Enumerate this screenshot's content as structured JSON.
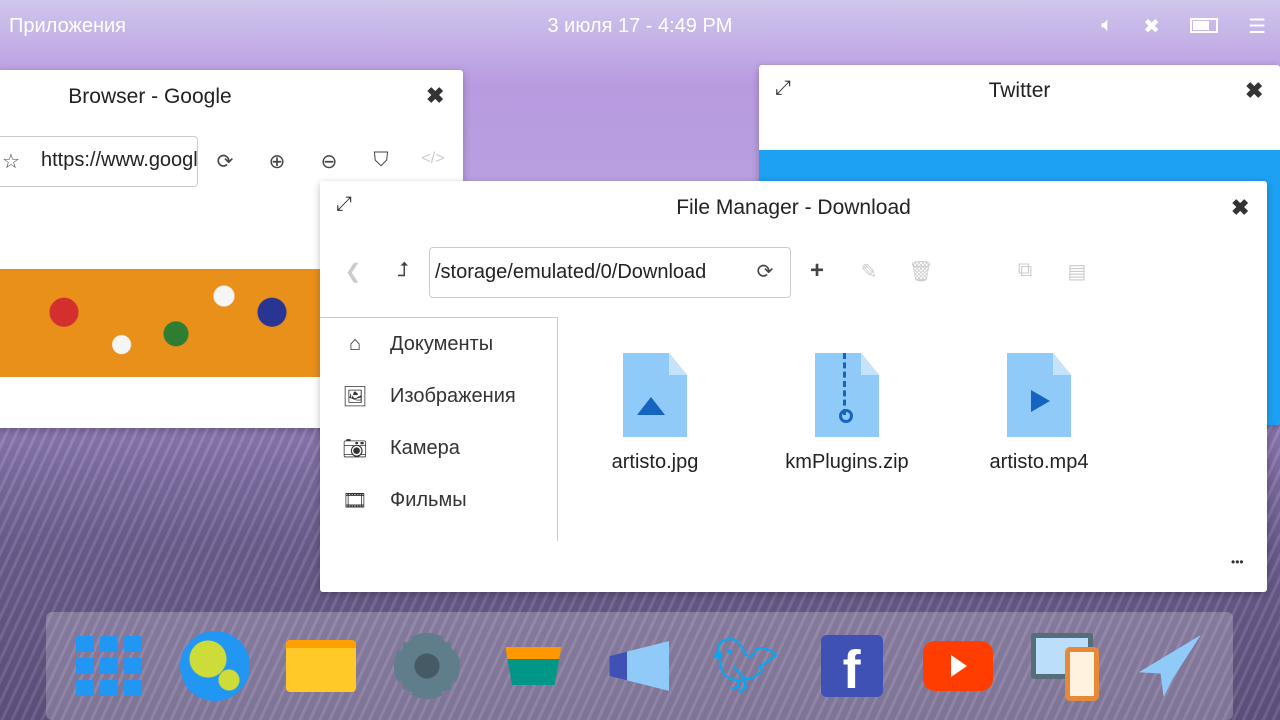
{
  "topbar": {
    "apps_label": "Приложения",
    "datetime": "3 июля 17 - 4:49 PM"
  },
  "browser": {
    "title": "Browser - Google",
    "url": "https://www.google.com"
  },
  "twitter": {
    "title": "Twitter"
  },
  "file_manager": {
    "title": "File Manager - Download",
    "path": "/storage/emulated/0/Download",
    "sidebar": [
      {
        "label": "Документы",
        "icon": "home-icon"
      },
      {
        "label": "Изображения",
        "icon": "image-icon"
      },
      {
        "label": "Камера",
        "icon": "camera-icon"
      },
      {
        "label": "Фильмы",
        "icon": "film-icon"
      }
    ],
    "files": [
      {
        "name": "artisto.jpg",
        "type": "image"
      },
      {
        "name": "kmPlugins.zip",
        "type": "zip"
      },
      {
        "name": "artisto.mp4",
        "type": "video"
      }
    ],
    "more_label": "•••"
  },
  "dock": [
    "apps-grid",
    "browser",
    "files",
    "settings",
    "store",
    "announcer",
    "twitter",
    "facebook",
    "youtube",
    "devices",
    "telegram"
  ],
  "colors": {
    "accent": "#1da1f2",
    "file_icon": "#90caf9",
    "file_icon_dark": "#1565c0"
  }
}
